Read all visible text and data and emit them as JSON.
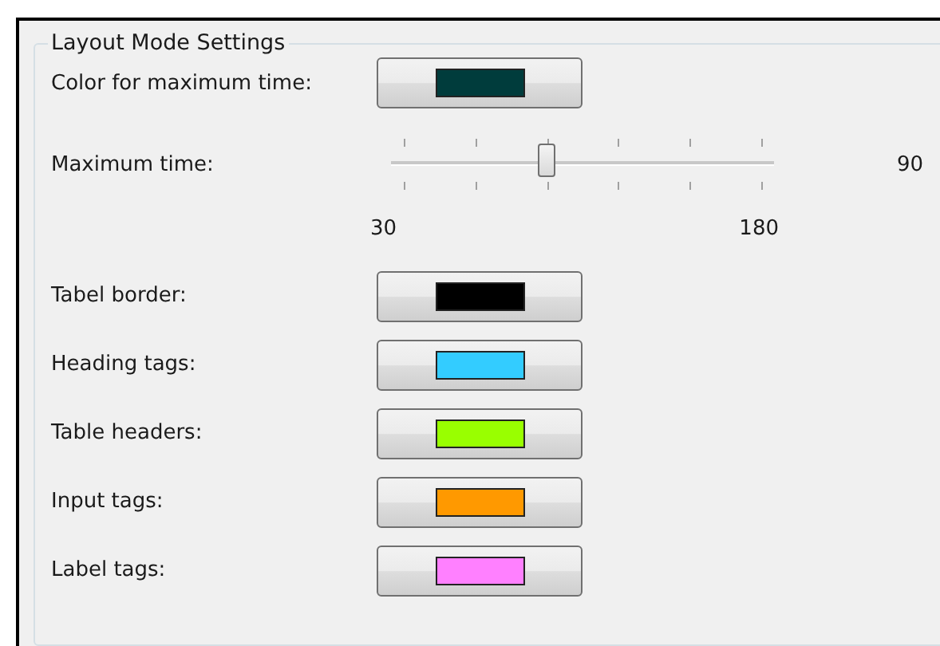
{
  "group": {
    "title": "Layout Mode Settings"
  },
  "rows": [
    {
      "kind": "color",
      "label": "Color for maximum time:",
      "color": "#003c3c"
    },
    {
      "kind": "slider",
      "label": "Maximum time:",
      "level": 0.4,
      "reading": "90",
      "min_label": "30",
      "max_label": "180"
    },
    {
      "kind": "color",
      "label": "Tabel border:",
      "color": "#000000"
    },
    {
      "kind": "color",
      "label": "Heading tags:",
      "color": "#33ccff"
    },
    {
      "kind": "color",
      "label": "Table headers:",
      "color": "#99ff00"
    },
    {
      "kind": "color",
      "label": "Input tags:",
      "color": "#ff9900"
    },
    {
      "kind": "color",
      "label": "Label tags:",
      "color": "#ff80ff"
    }
  ]
}
